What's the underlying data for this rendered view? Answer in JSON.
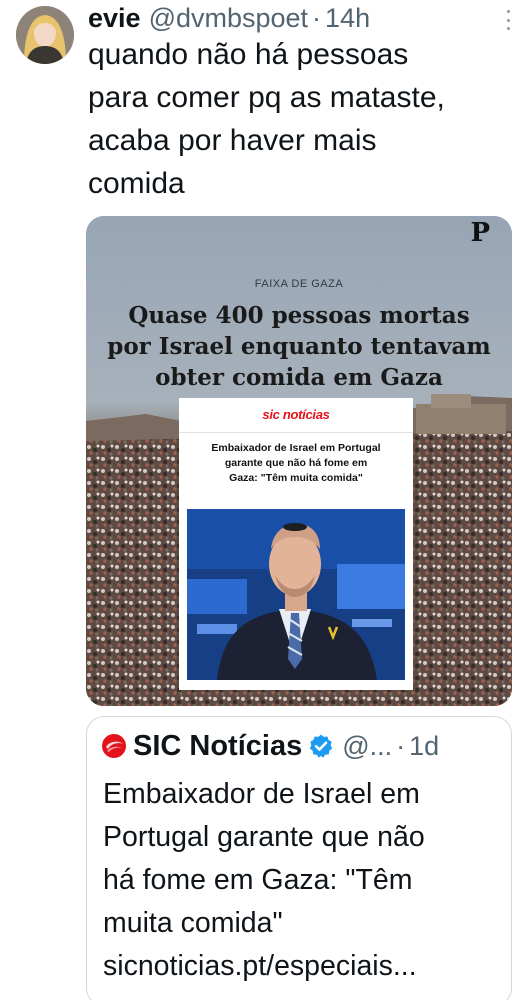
{
  "tweet": {
    "display_name": "evie",
    "handle": "@dvmbspoet",
    "separator": "·",
    "time": "14h",
    "text": "quando não há pessoas\npara comer pq as mataste,\nacaba por haver mais\ncomida",
    "more_icon": "more-vertical-icon"
  },
  "media": {
    "logo": "P",
    "kicker": "FAIXA DE GAZA",
    "headline": "Quase 400 pessoas mortas\npor Israel enquanto tentavam\nobter comida em Gaza",
    "inset": {
      "logo": "sic notícias",
      "headline": "Embaixador de Israel em Portugal\ngarante que não há fome em\nGaza: \"Têm muita comida\""
    }
  },
  "quoted": {
    "display_name": "SIC Notícias",
    "handle": "@...",
    "separator": "·",
    "time": "1d",
    "text": "Embaixador de Israel em\nPortugal garante que não\nhá fome em Gaza: \"Têm\nmuita comida\"\nsicnoticias.pt/especiais...",
    "verified_color": "#1d9bf0",
    "brand_color": "#e3131b"
  },
  "colors": {
    "text": "#0f1419",
    "secondary": "#536471",
    "border": "#cfd9de"
  }
}
